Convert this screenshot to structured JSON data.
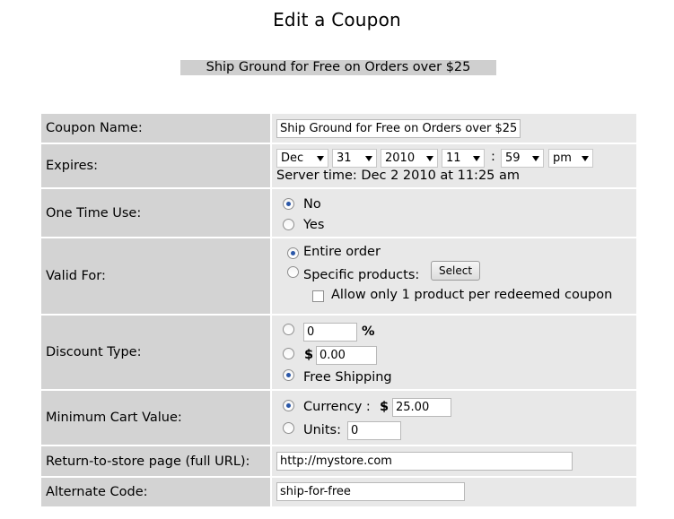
{
  "page": {
    "title": "Edit a Coupon",
    "subtitle": "Ship Ground for Free on Orders over $25"
  },
  "form": {
    "coupon_name": {
      "label": "Coupon Name:",
      "value": "Ship Ground for Free on Orders over $25"
    },
    "expires": {
      "label": "Expires:",
      "month": "Dec",
      "day": "31",
      "year": "2010",
      "hour": "11",
      "separator": ":",
      "minute": "59",
      "ampm": "pm",
      "server_time": "Server time: Dec 2 2010 at 11:25 am"
    },
    "one_time_use": {
      "label": "One Time Use:",
      "options": [
        "No",
        "Yes"
      ],
      "selected": "No"
    },
    "valid_for": {
      "label": "Valid For:",
      "entire_order": "Entire order",
      "specific_products": "Specific products:",
      "select_button": "Select",
      "allow_one_label": "Allow only 1 product per redeemed coupon",
      "selected": "Entire order",
      "allow_one_checked": false
    },
    "discount_type": {
      "label": "Discount Type:",
      "percent_value": "0",
      "percent_symbol": "%",
      "dollar_symbol": "$",
      "dollar_value": "0.00",
      "free_shipping": "Free Shipping",
      "selected": "Free Shipping"
    },
    "minimum_cart_value": {
      "label": "Minimum Cart Value:",
      "currency_label": "Currency :",
      "currency_symbol": "$",
      "currency_value": "25.00",
      "units_label": "Units:",
      "units_value": "0",
      "selected": "Currency"
    },
    "return_to_store": {
      "label": "Return-to-store page (full URL):",
      "value": "http://mystore.com"
    },
    "alternate_code": {
      "label": "Alternate Code:",
      "value": "ship-for-free"
    }
  },
  "colors": {
    "label_bg": "#d3d3d3",
    "value_bg": "#e8e8e8",
    "subtitle_bg": "#cfcfcf",
    "radio_dot": "#2a57a8"
  }
}
